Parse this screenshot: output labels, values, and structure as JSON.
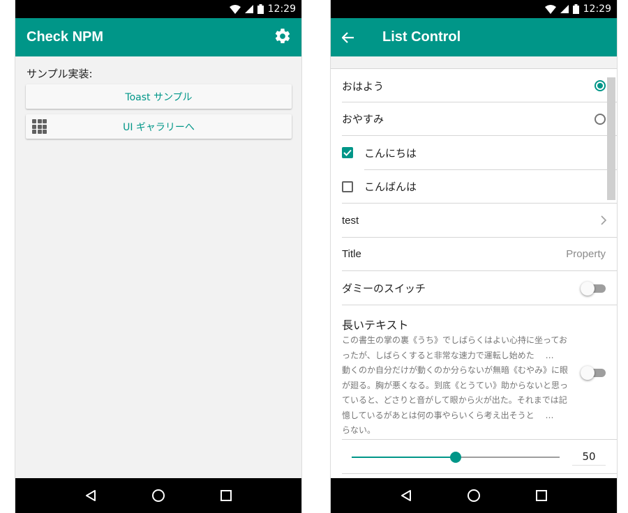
{
  "status": {
    "time": "12:29"
  },
  "left": {
    "appbar": {
      "title": "Check NPM",
      "settings_icon": "gear-icon"
    },
    "section_label": "サンプル実装:",
    "buttons": [
      {
        "label": "Toast サンプル"
      },
      {
        "label": "UI ギャラリーへ",
        "icon": "apps-grid-icon"
      }
    ]
  },
  "right": {
    "appbar": {
      "title": "List Control",
      "back_icon": "arrow-back-icon"
    },
    "radios": [
      {
        "label": "おはよう",
        "selected": true
      },
      {
        "label": "おやすみ",
        "selected": false
      }
    ],
    "checks": [
      {
        "label": "こんにちは",
        "checked": true
      },
      {
        "label": "こんばんは",
        "checked": false
      }
    ],
    "nav_item": {
      "label": "test"
    },
    "property": {
      "title": "Title",
      "value": "Property"
    },
    "switch_item": {
      "label": "ダミーのスイッチ",
      "on": false
    },
    "long_text": {
      "title": "長いテキスト",
      "body": "この書生の掌の裏《うち》でしばらくはよい心持に坐ってお\nったが、しばらくすると非常な速力で運転し始めた　 …\n動くのか自分だけが動くのか分らないが無暗《むやみ》に眼\nが廻る。胸が悪くなる。到底《とうてい》助からないと思っ\nていると、どさりと音がして眼から火が出た。それまでは記\n憶しているがあとは何の事やらいくら考え出そうと　 …\nらない。",
      "switch_on": false
    },
    "slider": {
      "value": 50,
      "min": 0,
      "max": 100,
      "display": "50"
    }
  },
  "colors": {
    "accent": "#009688",
    "background": "#f2f2f2"
  }
}
